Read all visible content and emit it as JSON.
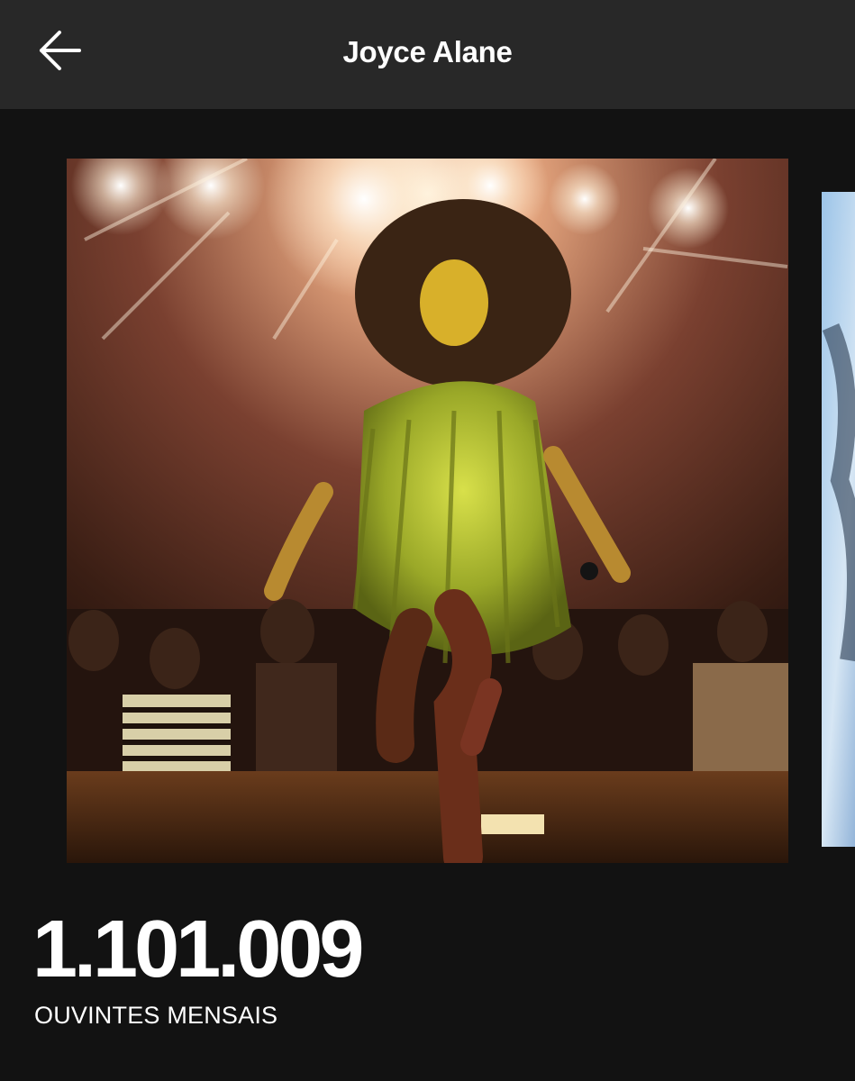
{
  "header": {
    "back_icon": "arrow-left-icon",
    "title": "Joyce Alane"
  },
  "gallery": {
    "current_photo": "concert-stage-photo",
    "next_photo": "next-photo-preview"
  },
  "stats": {
    "monthly_listeners": "1.101.009",
    "monthly_listeners_label": "OUVINTES MENSAIS"
  },
  "colors": {
    "background": "#121212",
    "header_background": "#282828",
    "text": "#ffffff"
  }
}
